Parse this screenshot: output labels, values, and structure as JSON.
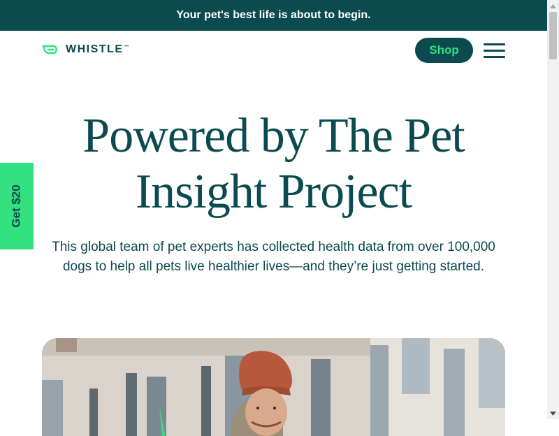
{
  "announcement": {
    "text": "Your pet's best life is about to begin."
  },
  "header": {
    "logo_text": "WHISTLE",
    "logo_tm": "™",
    "shop_label": "Shop",
    "menu_icon": "hamburger-menu-icon"
  },
  "hero": {
    "title": "Powered by The Pet Insight Project",
    "description": "This global team of pet experts has collected health data from over 100,000 dogs to help all pets live healthier lives—and they’re just getting started.",
    "image_subject": "person in orange beanie smiling outdoors"
  },
  "promo_tab": {
    "label": "Get $20"
  },
  "colors": {
    "brand_dark": "#0b4a4f",
    "accent_green": "#2de37a",
    "tab_green": "#33e27e",
    "background": "#ffffff"
  }
}
